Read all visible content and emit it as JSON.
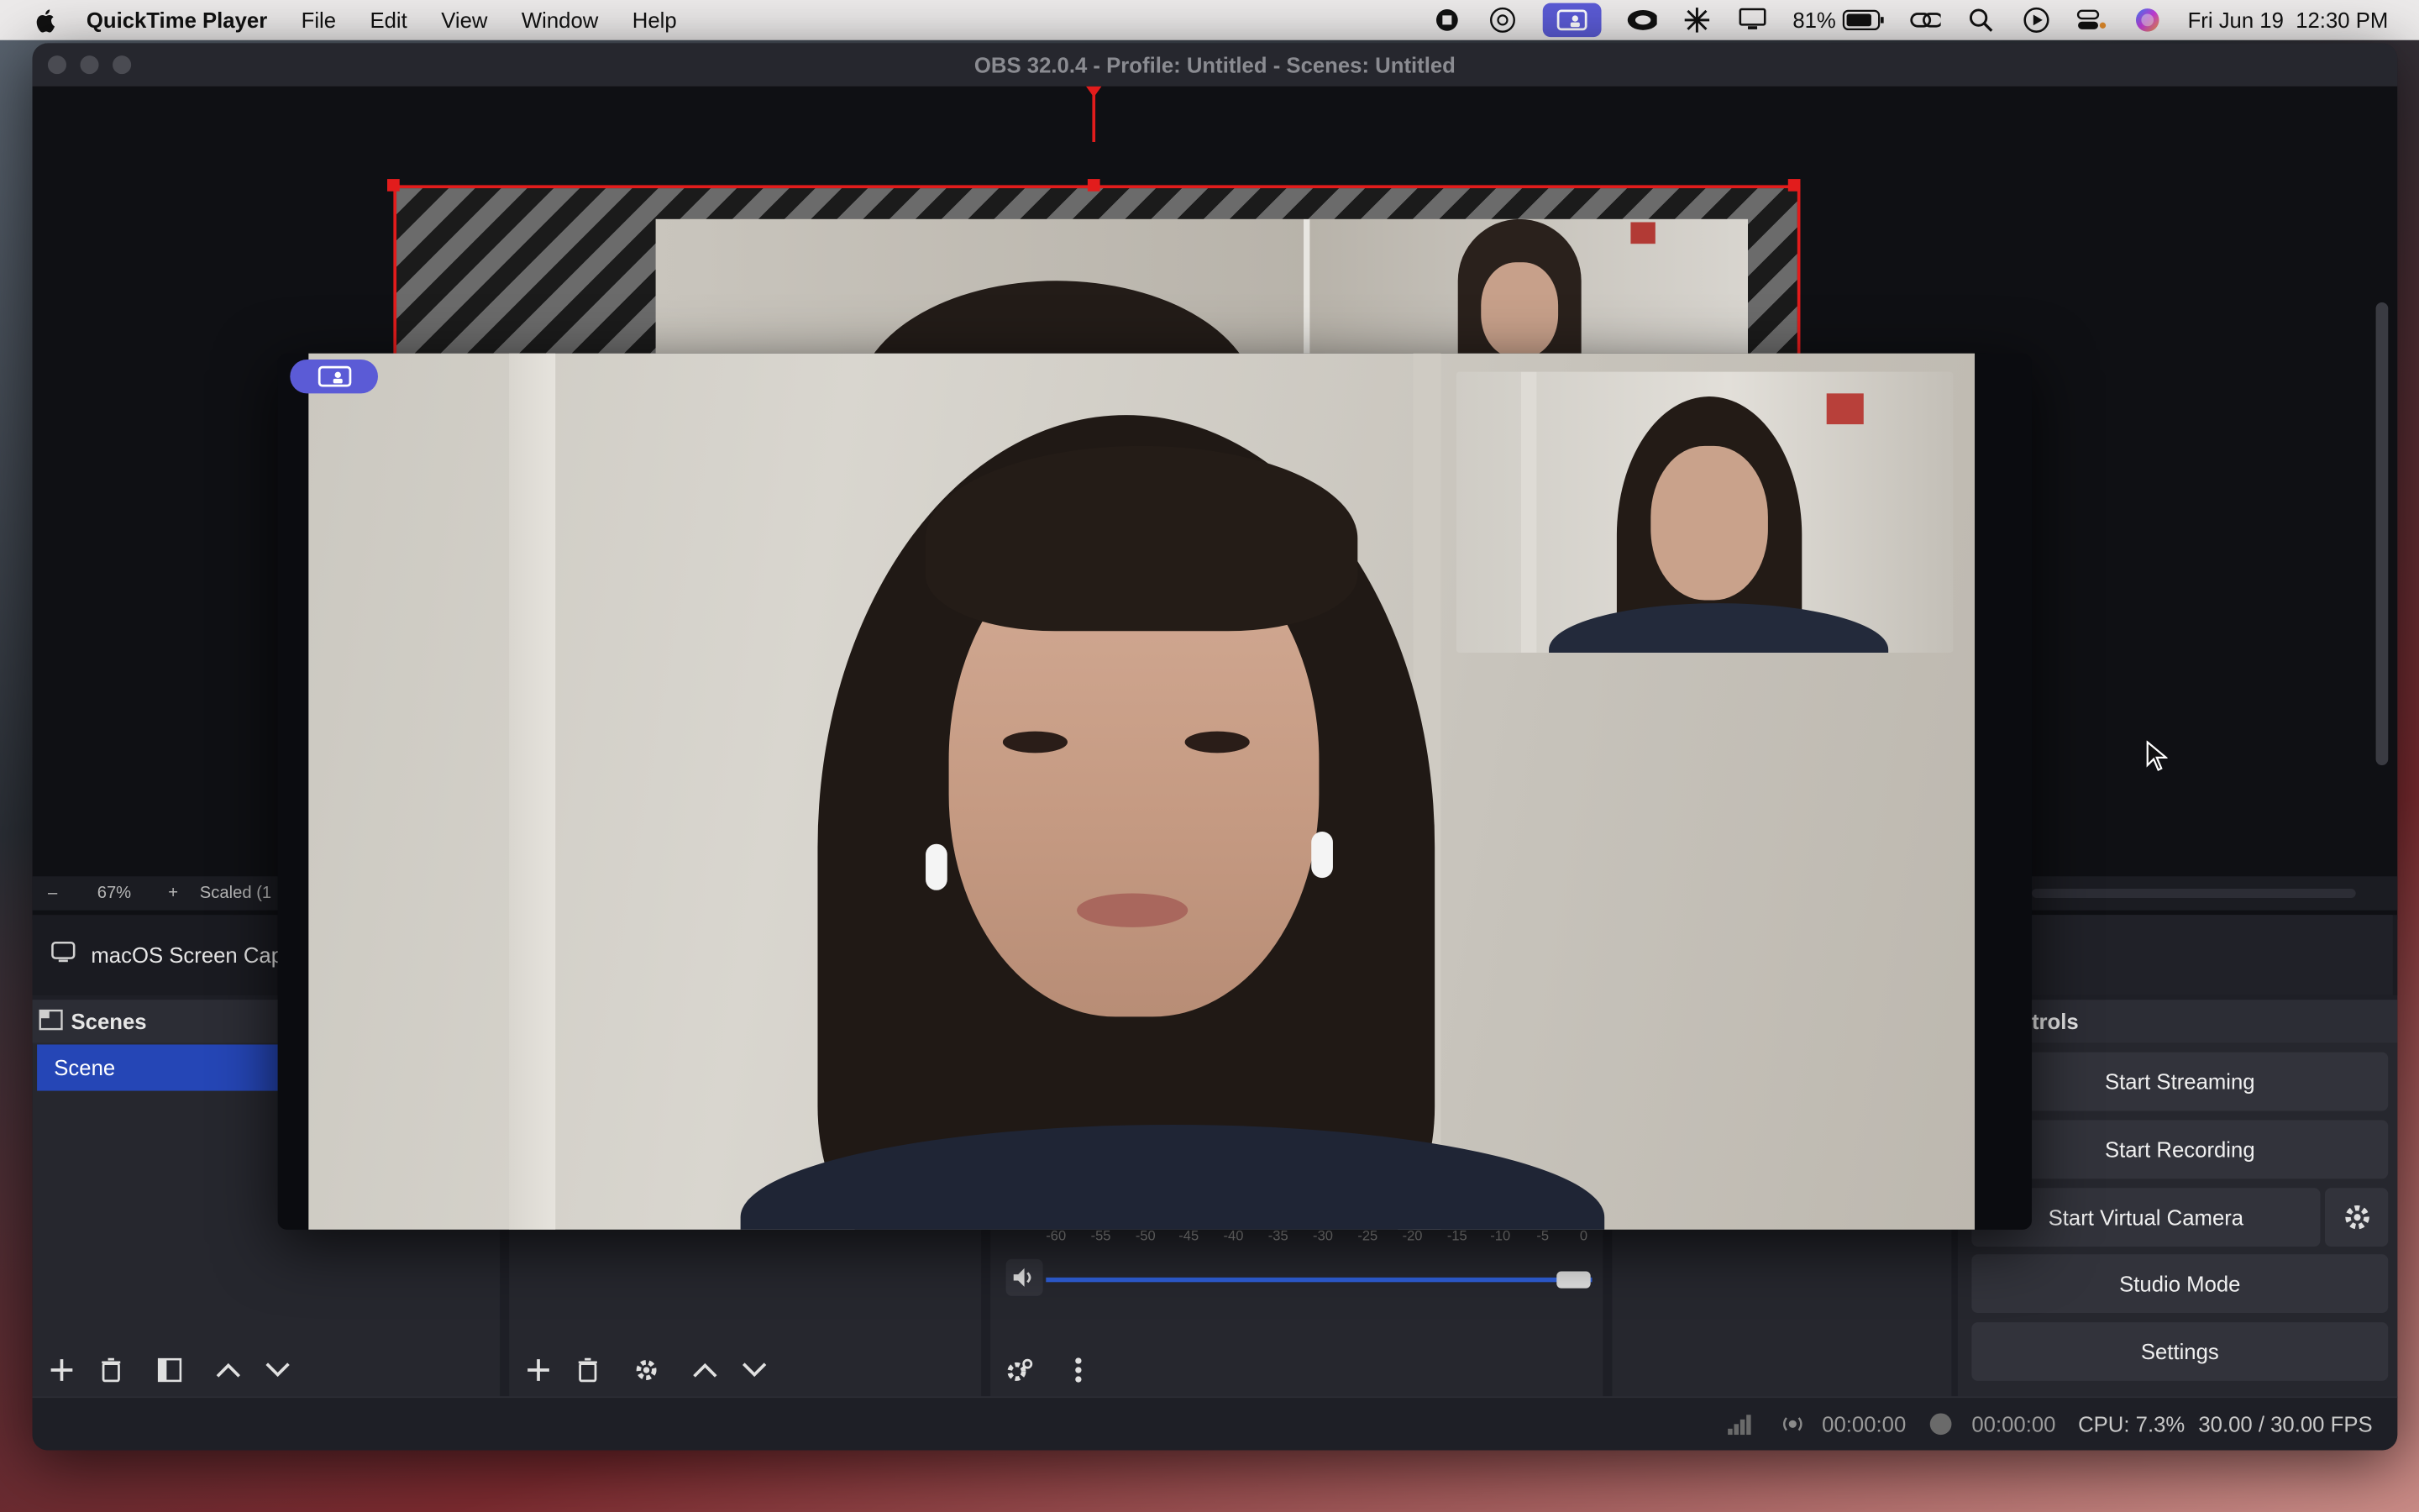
{
  "menubar": {
    "app_name": "QuickTime Player",
    "items": [
      "File",
      "Edit",
      "View",
      "Window",
      "Help"
    ],
    "battery": "81%",
    "datetime": "Fri Jun 19  12:30 PM",
    "icons": [
      "apple-logo-icon",
      "record-stop-icon",
      "aperture-icon",
      "screen-share-icon",
      "creative-cloud-icon",
      "sparkle-icon",
      "display-icon",
      "battery-icon",
      "link-icon",
      "search-icon",
      "play-icon",
      "control-center-icon",
      "siri-icon"
    ]
  },
  "window": {
    "title": "OBS 32.0.4 - Profile: Untitled - Scenes: Untitled"
  },
  "preview": {
    "zoom_minus": "–",
    "zoom_level": "67%",
    "zoom_plus": "+",
    "scale_label": "Scaled (1"
  },
  "source_bar": {
    "source_name": "macOS Screen Capt"
  },
  "scenes": {
    "header": "Scenes",
    "items": [
      "Scene"
    ]
  },
  "controls": {
    "header": "trols",
    "start_streaming": "Start Streaming",
    "start_recording": "Start Recording",
    "start_virtual_camera": "Start Virtual Camera",
    "studio_mode": "Studio Mode",
    "settings": "Settings"
  },
  "mixer": {
    "ticks": [
      "-60",
      "-55",
      "-50",
      "-45",
      "-40",
      "-35",
      "-30",
      "-25",
      "-20",
      "-15",
      "-10",
      "-5",
      "0"
    ],
    "volume_level": 1.0
  },
  "status": {
    "stream_time": "00:00:00",
    "record_time": "00:00:00",
    "cpu": "CPU: 7.3%",
    "fps": "30.00 / 30.00 FPS"
  },
  "colors": {
    "accent": "#2546b6",
    "selection": "#e21c1c",
    "pip_badge": "#5b5bd6"
  }
}
